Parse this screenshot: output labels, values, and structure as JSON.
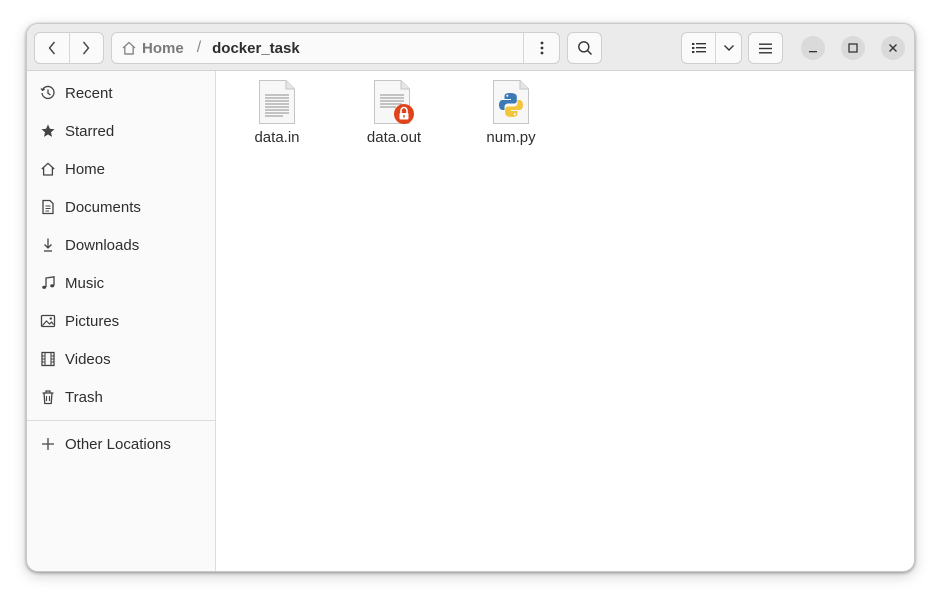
{
  "path": {
    "home_label": "Home",
    "separator": "/",
    "current": "docker_task"
  },
  "sidebar": {
    "items": [
      {
        "label": "Recent",
        "icon": "clock-icon"
      },
      {
        "label": "Starred",
        "icon": "star-icon"
      },
      {
        "label": "Home",
        "icon": "home-icon"
      },
      {
        "label": "Documents",
        "icon": "document-icon"
      },
      {
        "label": "Downloads",
        "icon": "download-icon"
      },
      {
        "label": "Music",
        "icon": "music-note-icon"
      },
      {
        "label": "Pictures",
        "icon": "picture-icon"
      },
      {
        "label": "Videos",
        "icon": "film-icon"
      },
      {
        "label": "Trash",
        "icon": "trash-icon"
      }
    ],
    "other_locations": {
      "label": "Other Locations",
      "icon": "plus-icon"
    }
  },
  "files": [
    {
      "name": "data.in",
      "icon": "text-file-icon"
    },
    {
      "name": "data.out",
      "icon": "locked-text-file-icon"
    },
    {
      "name": "num.py",
      "icon": "python-file-icon"
    }
  ],
  "colors": {
    "lock_badge": "#e0431b",
    "python_blue": "#3d7ab5",
    "python_yellow": "#f2c53d"
  }
}
